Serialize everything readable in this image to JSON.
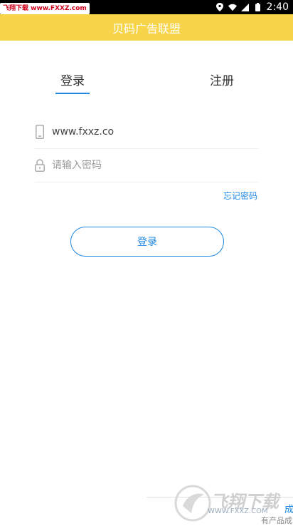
{
  "status_bar": {
    "watermark": "飞翔下载 www.FXXZ.com",
    "time": "2:40",
    "icons": [
      "location-icon",
      "wifi-icon",
      "signal-icon",
      "battery-icon"
    ]
  },
  "app_bar": {
    "title": "贝码广告联盟"
  },
  "tabs": {
    "login": "登录",
    "register": "注册",
    "active": "login"
  },
  "form": {
    "phone_value": "www.fxxz.co",
    "password_placeholder": "请输入密码",
    "forgot_label": "忘记密码",
    "submit_label": "登录"
  },
  "footer_watermark": {
    "title": "飞翔下载",
    "url": "WWW.FXXZ.COM",
    "cut_text_1": "成",
    "cut_text_2": "有产品成"
  },
  "colors": {
    "appbar": "#f8d44b",
    "accent": "#1e88e5",
    "statusbar": "#000000"
  }
}
